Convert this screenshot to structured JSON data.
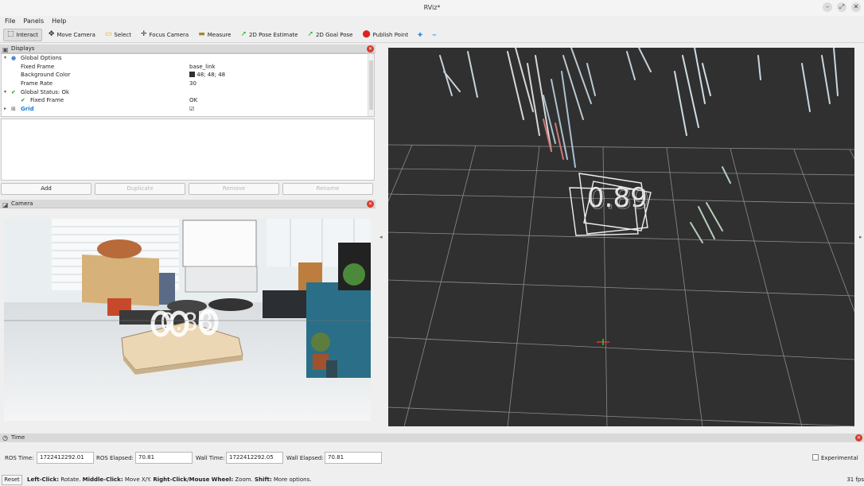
{
  "window": {
    "title": "RViz*",
    "min": "–",
    "max": "⤢",
    "close": "✕"
  },
  "menu": [
    "File",
    "Panels",
    "Help"
  ],
  "toolbar": {
    "interact": "Interact",
    "move_camera": "Move Camera",
    "select": "Select",
    "focus_camera": "Focus Camera",
    "measure": "Measure",
    "pose_estimate": "2D Pose Estimate",
    "goal_pose": "2D Goal Pose",
    "publish_point": "Publish Point",
    "add_tool": "✚",
    "remove_tool": "−"
  },
  "displays": {
    "title": "Displays",
    "rows": [
      {
        "label": "Global Options",
        "value": "",
        "indent": 0,
        "expand": "▾",
        "icon": "globe"
      },
      {
        "label": "Fixed Frame",
        "value": "base_link",
        "indent": 1
      },
      {
        "label": "Background Color",
        "value": "48; 48; 48",
        "indent": 1,
        "swatch": "#303030"
      },
      {
        "label": "Frame Rate",
        "value": "30",
        "indent": 1
      },
      {
        "label": "Global Status: Ok",
        "value": "",
        "indent": 0,
        "expand": "▾",
        "check": true
      },
      {
        "label": "Fixed Frame",
        "value": "OK",
        "indent": 1,
        "check": true
      },
      {
        "label": "Grid",
        "value": "☑",
        "indent": 0,
        "expand": "▸",
        "icon": "grid",
        "blue": true
      }
    ],
    "buttons": {
      "add": "Add",
      "duplicate": "Duplicate",
      "remove": "Remove",
      "rename": "Rename"
    }
  },
  "camera_panel": {
    "title": "Camera",
    "overlay_text": "0.88"
  },
  "view3d": {
    "overlay_text": "0.89"
  },
  "time_panel": {
    "title": "Time",
    "ros_time_label": "ROS Time:",
    "ros_time": "1722412292.01",
    "ros_elapsed_label": "ROS Elapsed:",
    "ros_elapsed": "70.81",
    "wall_time_label": "Wall Time:",
    "wall_time": "1722412292.05",
    "wall_elapsed_label": "Wall Elapsed:",
    "wall_elapsed": "70.81",
    "experimental": "Experimental"
  },
  "status": {
    "reset": "Reset",
    "left_click": "Left-Click:",
    "left_action": " Rotate. ",
    "middle_click": "Middle-Click:",
    "middle_action": " Move X/Y. ",
    "right_click": "Right-Click/Mouse Wheel:",
    "right_action": " Zoom. ",
    "shift": "Shift:",
    "shift_action": " More options.",
    "fps": "31 fps"
  },
  "colors": {
    "accent_blue": "#1f7bd6",
    "close_red": "#d8392b",
    "viewport_bg": "#303030",
    "grid": "#9a9a9a"
  }
}
